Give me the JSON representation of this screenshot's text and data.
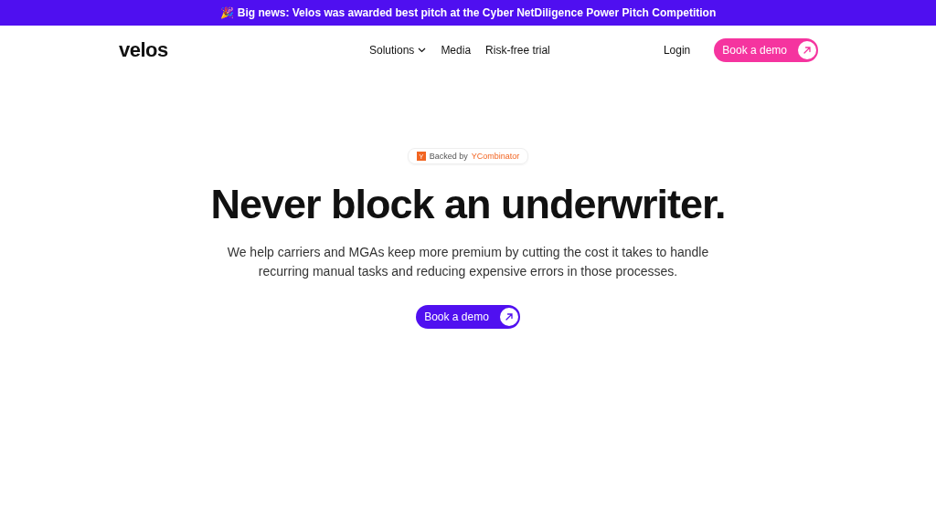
{
  "announcement": {
    "emoji": "🎉",
    "text": "Big news: Velos was awarded best pitch at the Cyber NetDiligence Power Pitch Competition"
  },
  "nav": {
    "logo": "velos",
    "links": [
      {
        "label": "Solutions",
        "kind": "dropdown"
      },
      {
        "label": "Media",
        "kind": "link"
      },
      {
        "label": "Risk-free trial",
        "kind": "link"
      }
    ],
    "login": "Login",
    "cta": "Book a demo"
  },
  "hero": {
    "badge": {
      "logo": "Y",
      "prefix": "Backed by",
      "brand": "YCombinator"
    },
    "title": "Never block an underwriter.",
    "subtitle": "We help carriers and MGAs keep more premium by cutting the cost it takes to handle recurring manual tasks and reducing expensive errors in those processes.",
    "cta": "Book a demo"
  }
}
